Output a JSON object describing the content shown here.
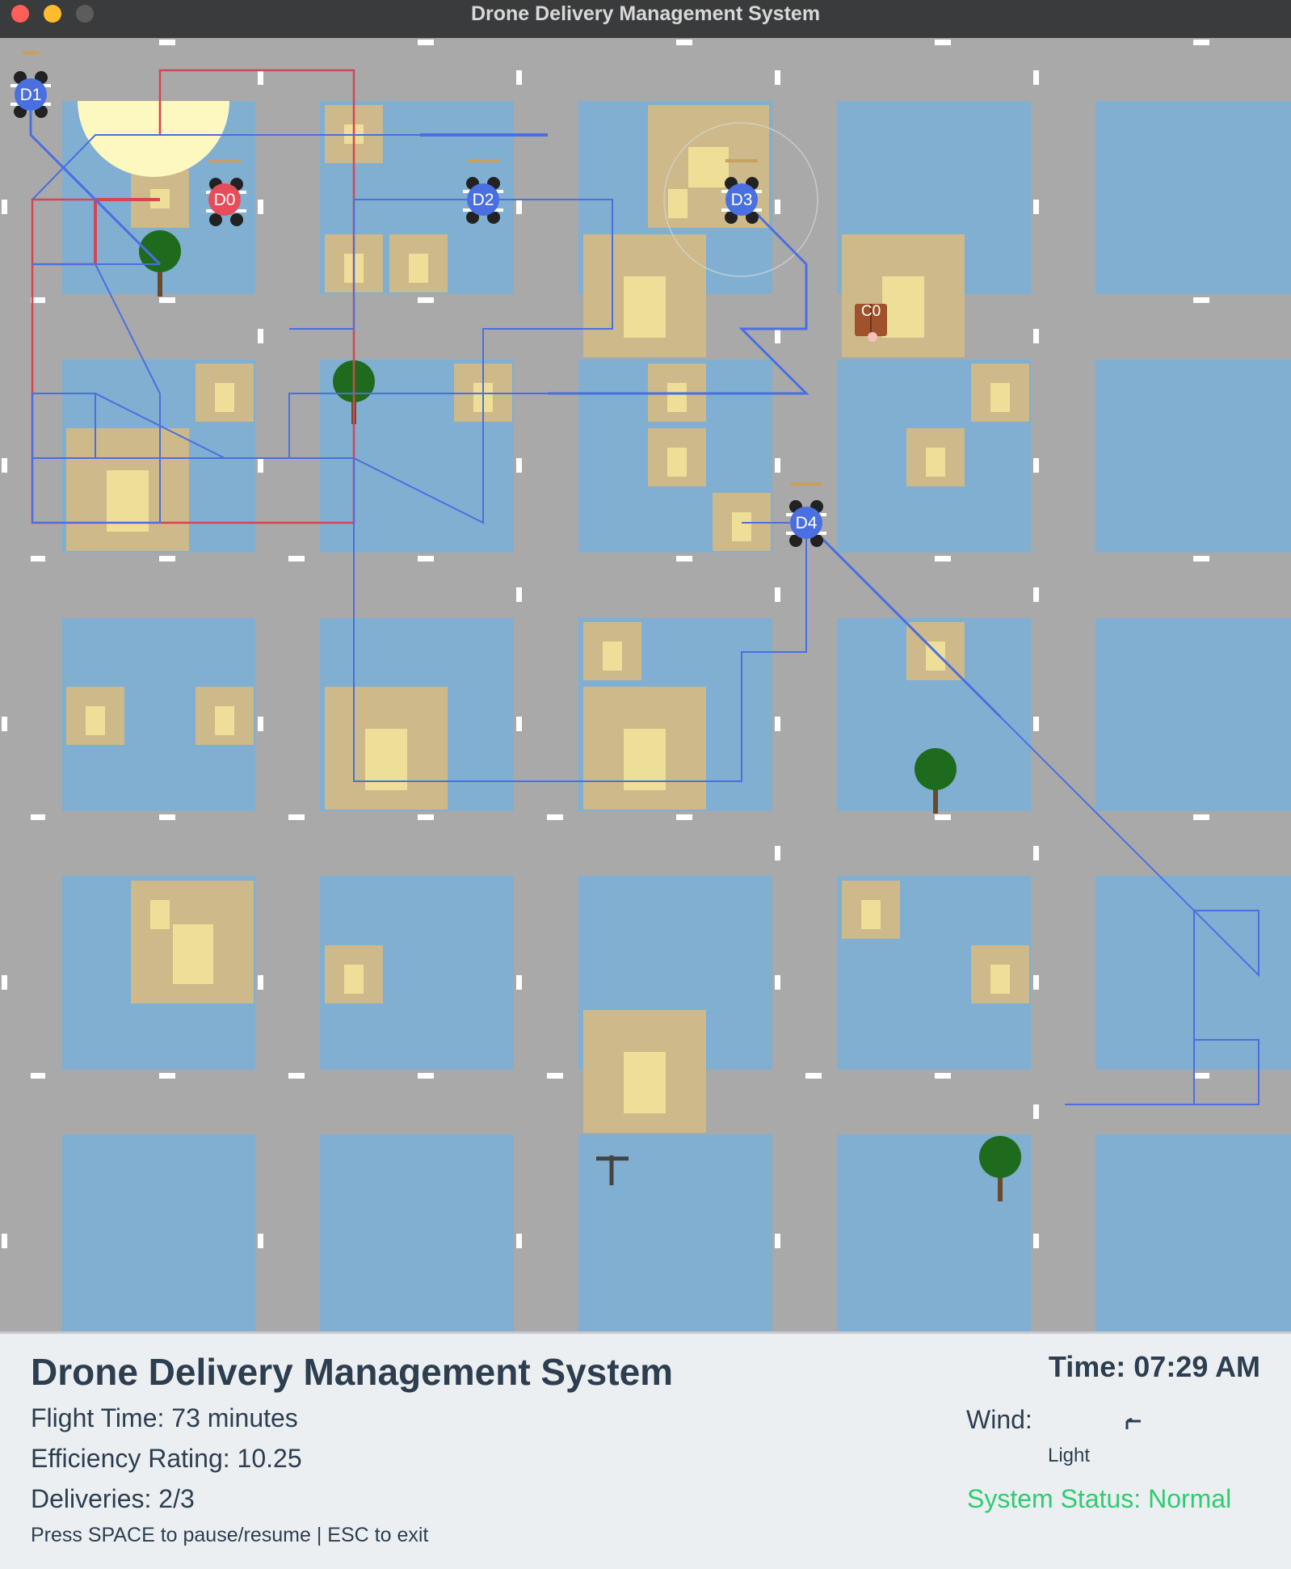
{
  "window": {
    "title": "Drone Delivery Management System"
  },
  "map": {
    "drones": [
      {
        "id": "D0",
        "label": "D0",
        "color": "#e74c5a",
        "status": "returning"
      },
      {
        "id": "D1",
        "label": "D1",
        "color": "#4a6fe0",
        "status": "idle"
      },
      {
        "id": "D2",
        "label": "D2",
        "color": "#4a6fe0",
        "status": "delivering"
      },
      {
        "id": "D3",
        "label": "D3",
        "color": "#4a6fe0",
        "status": "delivering"
      },
      {
        "id": "D4",
        "label": "D4",
        "color": "#4a6fe0",
        "status": "delivering"
      }
    ],
    "customer": {
      "label": "C0"
    },
    "colors": {
      "road": "#a9a9a9",
      "block": "#80afd1",
      "building": "#cdb989",
      "building_core": "#eedf98",
      "route_blue": "#4a6fe0",
      "route_red": "#d64553",
      "tree": "#1e6b1e"
    }
  },
  "panel": {
    "title": "Drone Delivery Management System",
    "flight_time": "Flight Time: 73 minutes",
    "efficiency": "Efficiency Rating: 10.25",
    "deliveries": "Deliveries: 2/3",
    "hint": "Press SPACE to pause/resume | ESC to exit",
    "time": "Time: 07:29 AM",
    "wind_label": "Wind:",
    "wind_level": "Light",
    "wind_icon": "wind-arrow-icon",
    "status": "System Status: Normal",
    "status_color": "#2ecc71"
  }
}
